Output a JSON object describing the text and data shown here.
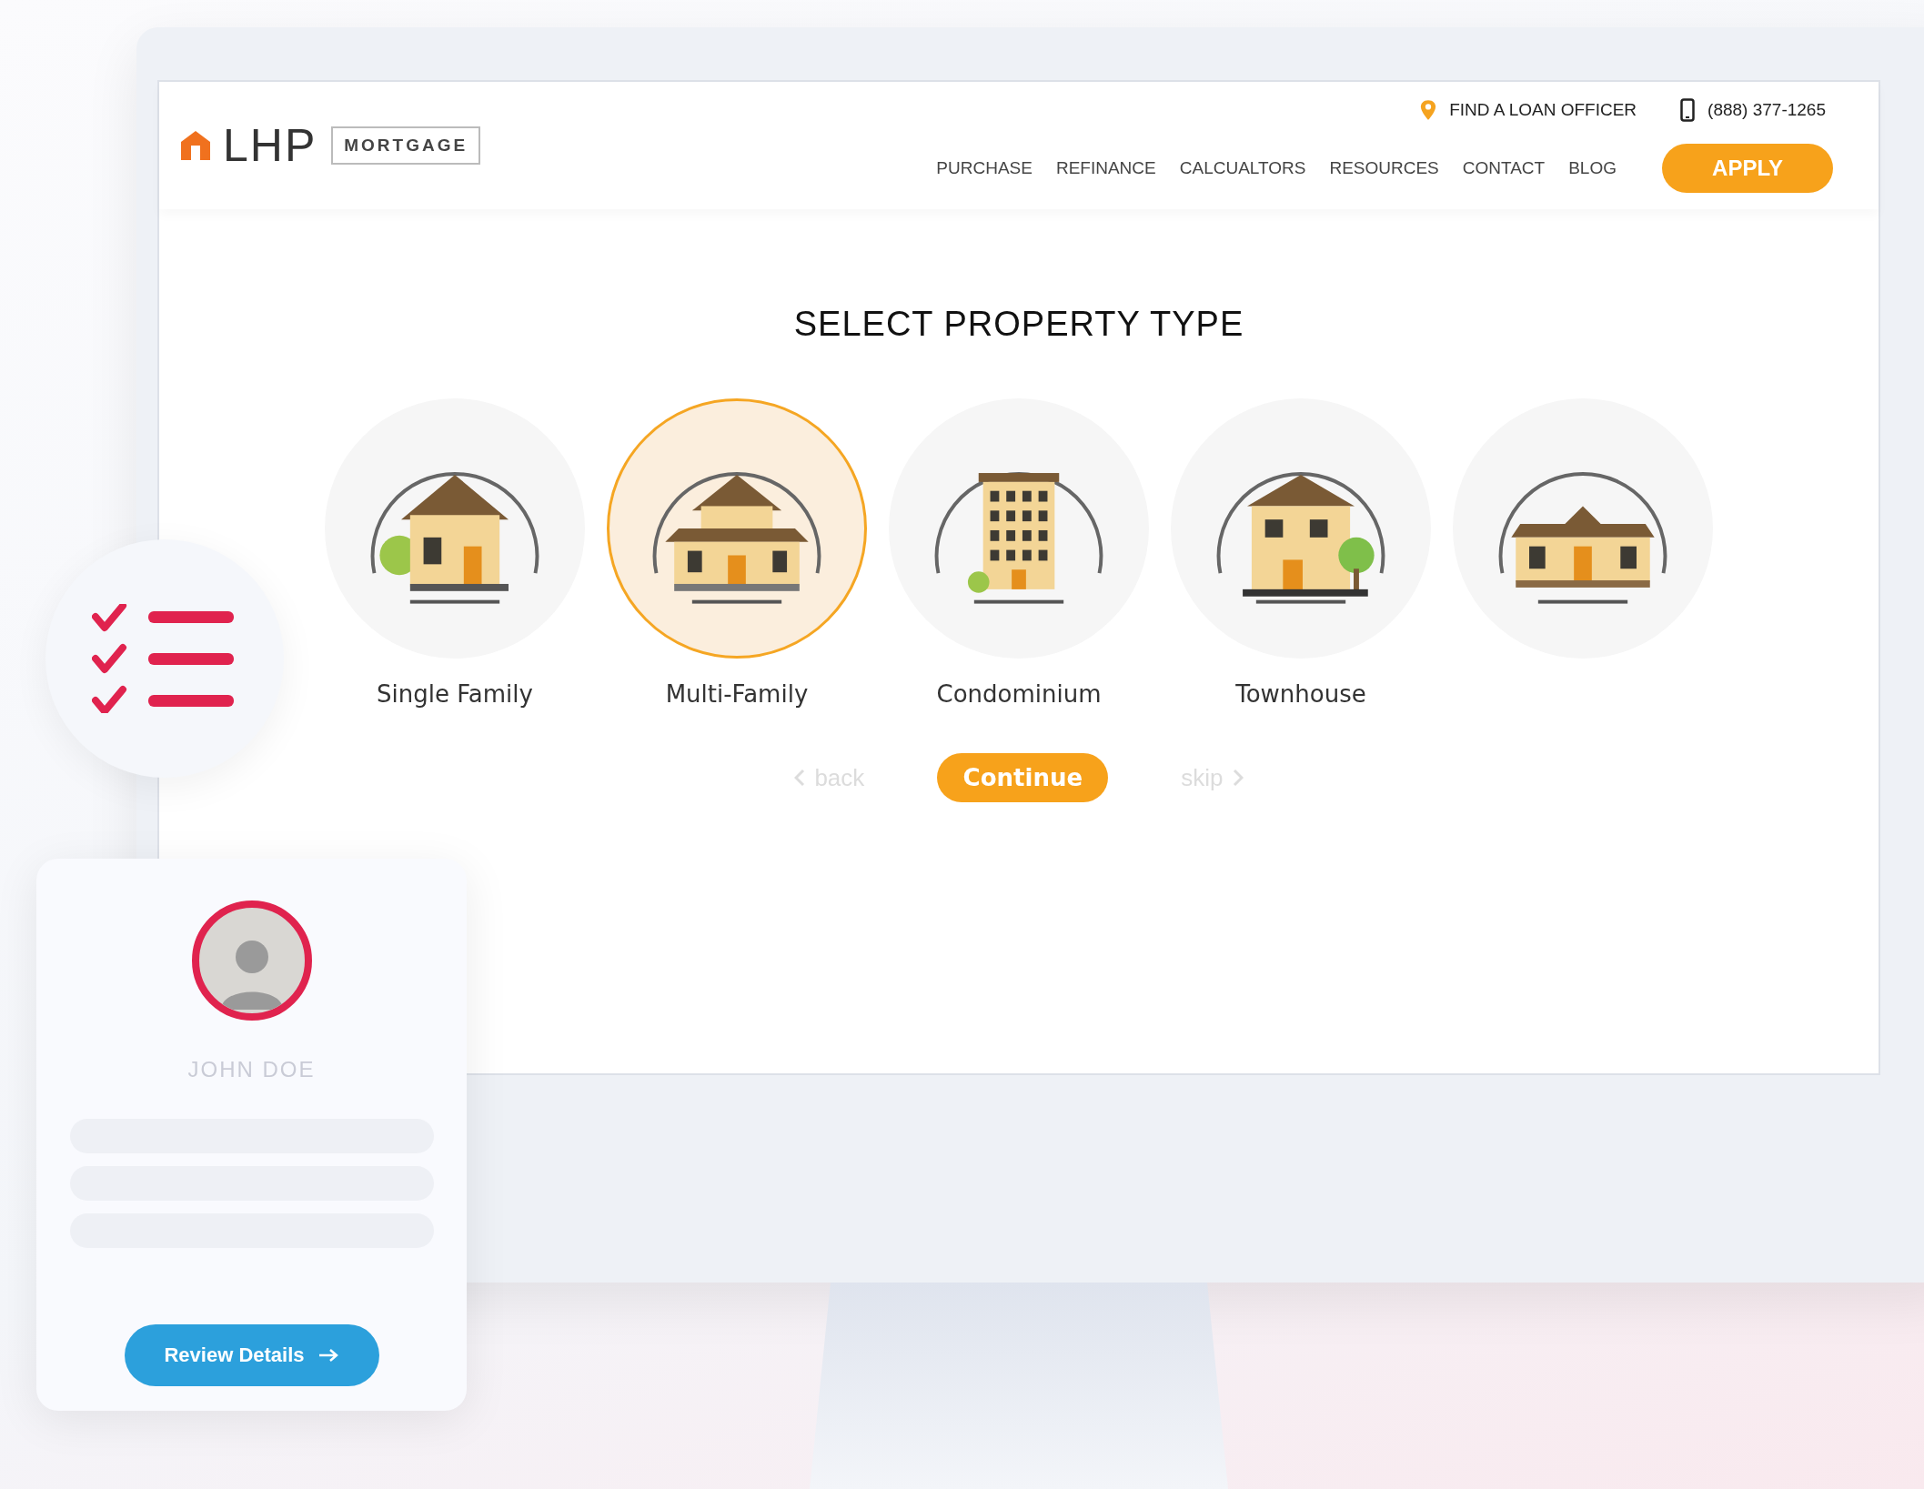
{
  "header": {
    "logo": {
      "wordmark": "LHP",
      "tag": "MORTGAGE"
    },
    "top_links": [
      {
        "kind": "pin",
        "label": "FIND A LOAN OFFICER"
      },
      {
        "kind": "phone",
        "label": "(888) 377-1265"
      }
    ],
    "nav": [
      "PURCHASE",
      "REFINANCE",
      "CALCUALTORS",
      "RESOURCES",
      "CONTACT",
      "BLOG"
    ],
    "apply_button": "APPLY"
  },
  "title": "SELECT PROPERTY TYPE",
  "property_types": [
    {
      "kind": "house",
      "label": "Single Family",
      "selected": false
    },
    {
      "kind": "multi",
      "label": "Multi-Family",
      "selected": true
    },
    {
      "kind": "condo",
      "label": "Condominium",
      "selected": false
    },
    {
      "kind": "townhouse",
      "label": "Townhouse",
      "selected": false
    },
    {
      "kind": "ranch",
      "selected": false
    }
  ],
  "steps": [
    {
      "kind": "back",
      "label": "back",
      "disabled": true
    },
    {
      "kind": "continue",
      "label": "Continue",
      "disabled": false
    },
    {
      "kind": "skip",
      "label": "skip",
      "disabled": true
    }
  ],
  "profile_card": {
    "name": "JOHN DOE",
    "button": "Review Details"
  }
}
